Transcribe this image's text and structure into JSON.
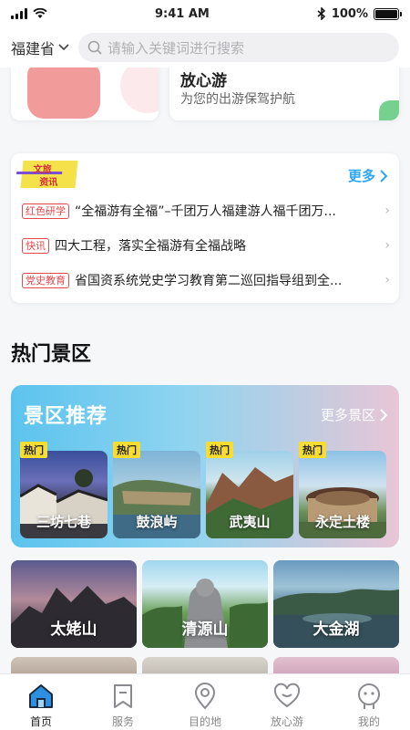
{
  "status_bar": {
    "time": "9:41 AM",
    "battery": "100%"
  },
  "header": {
    "province": "福建省",
    "search_placeholder": "请输入关键词进行搜索"
  },
  "top_cards": {
    "right_title": "放心游",
    "right_subtitle": "为您的出游保驾护航"
  },
  "news": {
    "logo_line1": "文旅",
    "logo_line2": "资讯",
    "more_label": "更多",
    "items": [
      {
        "tag": "红色研学",
        "text": "“全福游有全福”–千团万人福建游人福千团万..."
      },
      {
        "tag": "快讯",
        "text": "四大工程，落实全福游有全福战略"
      },
      {
        "tag": "党史教育",
        "text": "省国资系统党史学习教育第二巡回指导组到全..."
      }
    ]
  },
  "hot_section": {
    "title": "热门景区"
  },
  "recommend": {
    "title": "景区推荐",
    "more_label": "更多景区",
    "hot_badge": "热门",
    "spots": [
      {
        "name": "三坊七巷"
      },
      {
        "name": "鼓浪屿"
      },
      {
        "name": "武夷山"
      },
      {
        "name": "永定土楼"
      }
    ]
  },
  "scenic_grid": [
    {
      "name": "太姥山"
    },
    {
      "name": "清源山"
    },
    {
      "name": "大金湖"
    }
  ],
  "tabbar": {
    "items": [
      {
        "label": "首页",
        "icon": "home-icon",
        "active": true
      },
      {
        "label": "服务",
        "icon": "bookmark-icon",
        "active": false
      },
      {
        "label": "目的地",
        "icon": "location-pin-icon",
        "active": false
      },
      {
        "label": "放心游",
        "icon": "heart-icon",
        "active": false
      },
      {
        "label": "我的",
        "icon": "user-face-icon",
        "active": false
      }
    ]
  },
  "colors": {
    "accent": "#2ea8f0",
    "tag_red": "#e5484d",
    "hot_yellow": "#f6dd2f"
  }
}
